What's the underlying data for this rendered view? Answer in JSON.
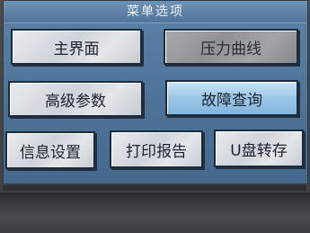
{
  "window": {
    "title": "菜单选项"
  },
  "menu": {
    "main_screen": "主界面",
    "pressure_curve": "压力曲线",
    "advanced_params": "高级参数",
    "fault_query": "故障查询",
    "info_settings": "信息设置",
    "print_report": "打印报告",
    "usb_transfer": "U盘转存"
  },
  "colors": {
    "screen_blue": "#4d7397",
    "button_silver": "#d7dbe0",
    "button_gray": "#9a9c9e",
    "button_selected_blue": "#9cc7e8"
  }
}
